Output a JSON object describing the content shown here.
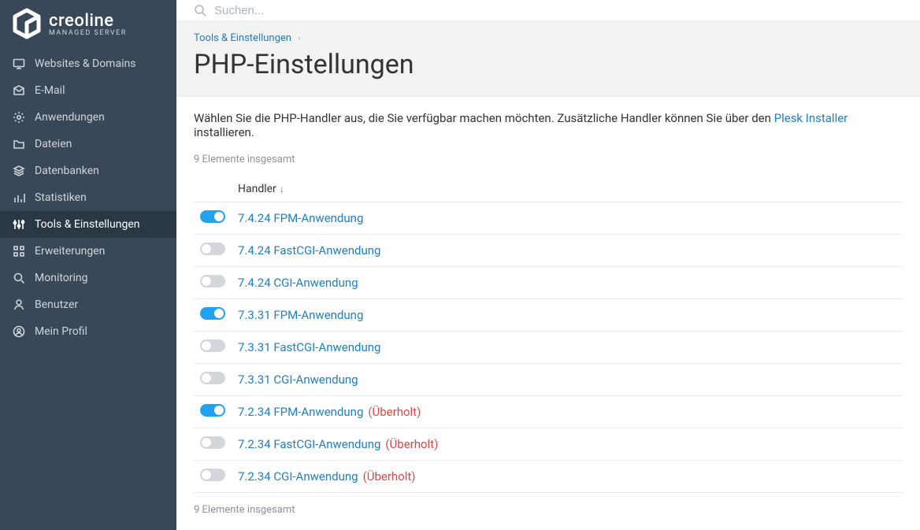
{
  "brand": {
    "name": "creoline",
    "subtitle": "MANAGED SERVER"
  },
  "search": {
    "placeholder": "Suchen..."
  },
  "sidebar": {
    "items": [
      {
        "label": "Websites & Domains",
        "icon": "monitor-icon"
      },
      {
        "label": "E-Mail",
        "icon": "envelope-icon"
      },
      {
        "label": "Anwendungen",
        "icon": "gear-icon"
      },
      {
        "label": "Dateien",
        "icon": "folder-icon"
      },
      {
        "label": "Datenbanken",
        "icon": "layers-icon"
      },
      {
        "label": "Statistiken",
        "icon": "bars-icon"
      },
      {
        "label": "Tools & Einstellungen",
        "icon": "sliders-icon",
        "active": true
      },
      {
        "label": "Erweiterungen",
        "icon": "grid-icon"
      },
      {
        "label": "Monitoring",
        "icon": "magnify-icon"
      },
      {
        "label": "Benutzer",
        "icon": "user-icon"
      },
      {
        "label": "Mein Profil",
        "icon": "profile-icon"
      }
    ]
  },
  "breadcrumb": {
    "item": "Tools & Einstellungen"
  },
  "page": {
    "title": "PHP-Einstellungen"
  },
  "intro": {
    "before": "Wählen Sie die PHP-Handler aus, die Sie verfügbar machen möchten. Zusätzliche Handler können Sie über den ",
    "link": "Plesk Installer",
    "after": " installieren."
  },
  "totals": {
    "text": "9 Elemente insgesamt"
  },
  "table": {
    "header": {
      "handler": "Handler"
    },
    "rows": [
      {
        "enabled": true,
        "name": "7.4.24 FPM-Anwendung"
      },
      {
        "enabled": false,
        "name": "7.4.24 FastCGI-Anwendung"
      },
      {
        "enabled": false,
        "name": "7.4.24 CGI-Anwendung"
      },
      {
        "enabled": true,
        "name": "7.3.31 FPM-Anwendung"
      },
      {
        "enabled": false,
        "name": "7.3.31 FastCGI-Anwendung"
      },
      {
        "enabled": false,
        "name": "7.3.31 CGI-Anwendung"
      },
      {
        "enabled": true,
        "name": "7.2.34 FPM-Anwendung",
        "outdated": "(Überholt)"
      },
      {
        "enabled": false,
        "name": "7.2.34 FastCGI-Anwendung",
        "outdated": "(Überholt)"
      },
      {
        "enabled": false,
        "name": "7.2.34 CGI-Anwendung",
        "outdated": "(Überholt)"
      }
    ]
  }
}
